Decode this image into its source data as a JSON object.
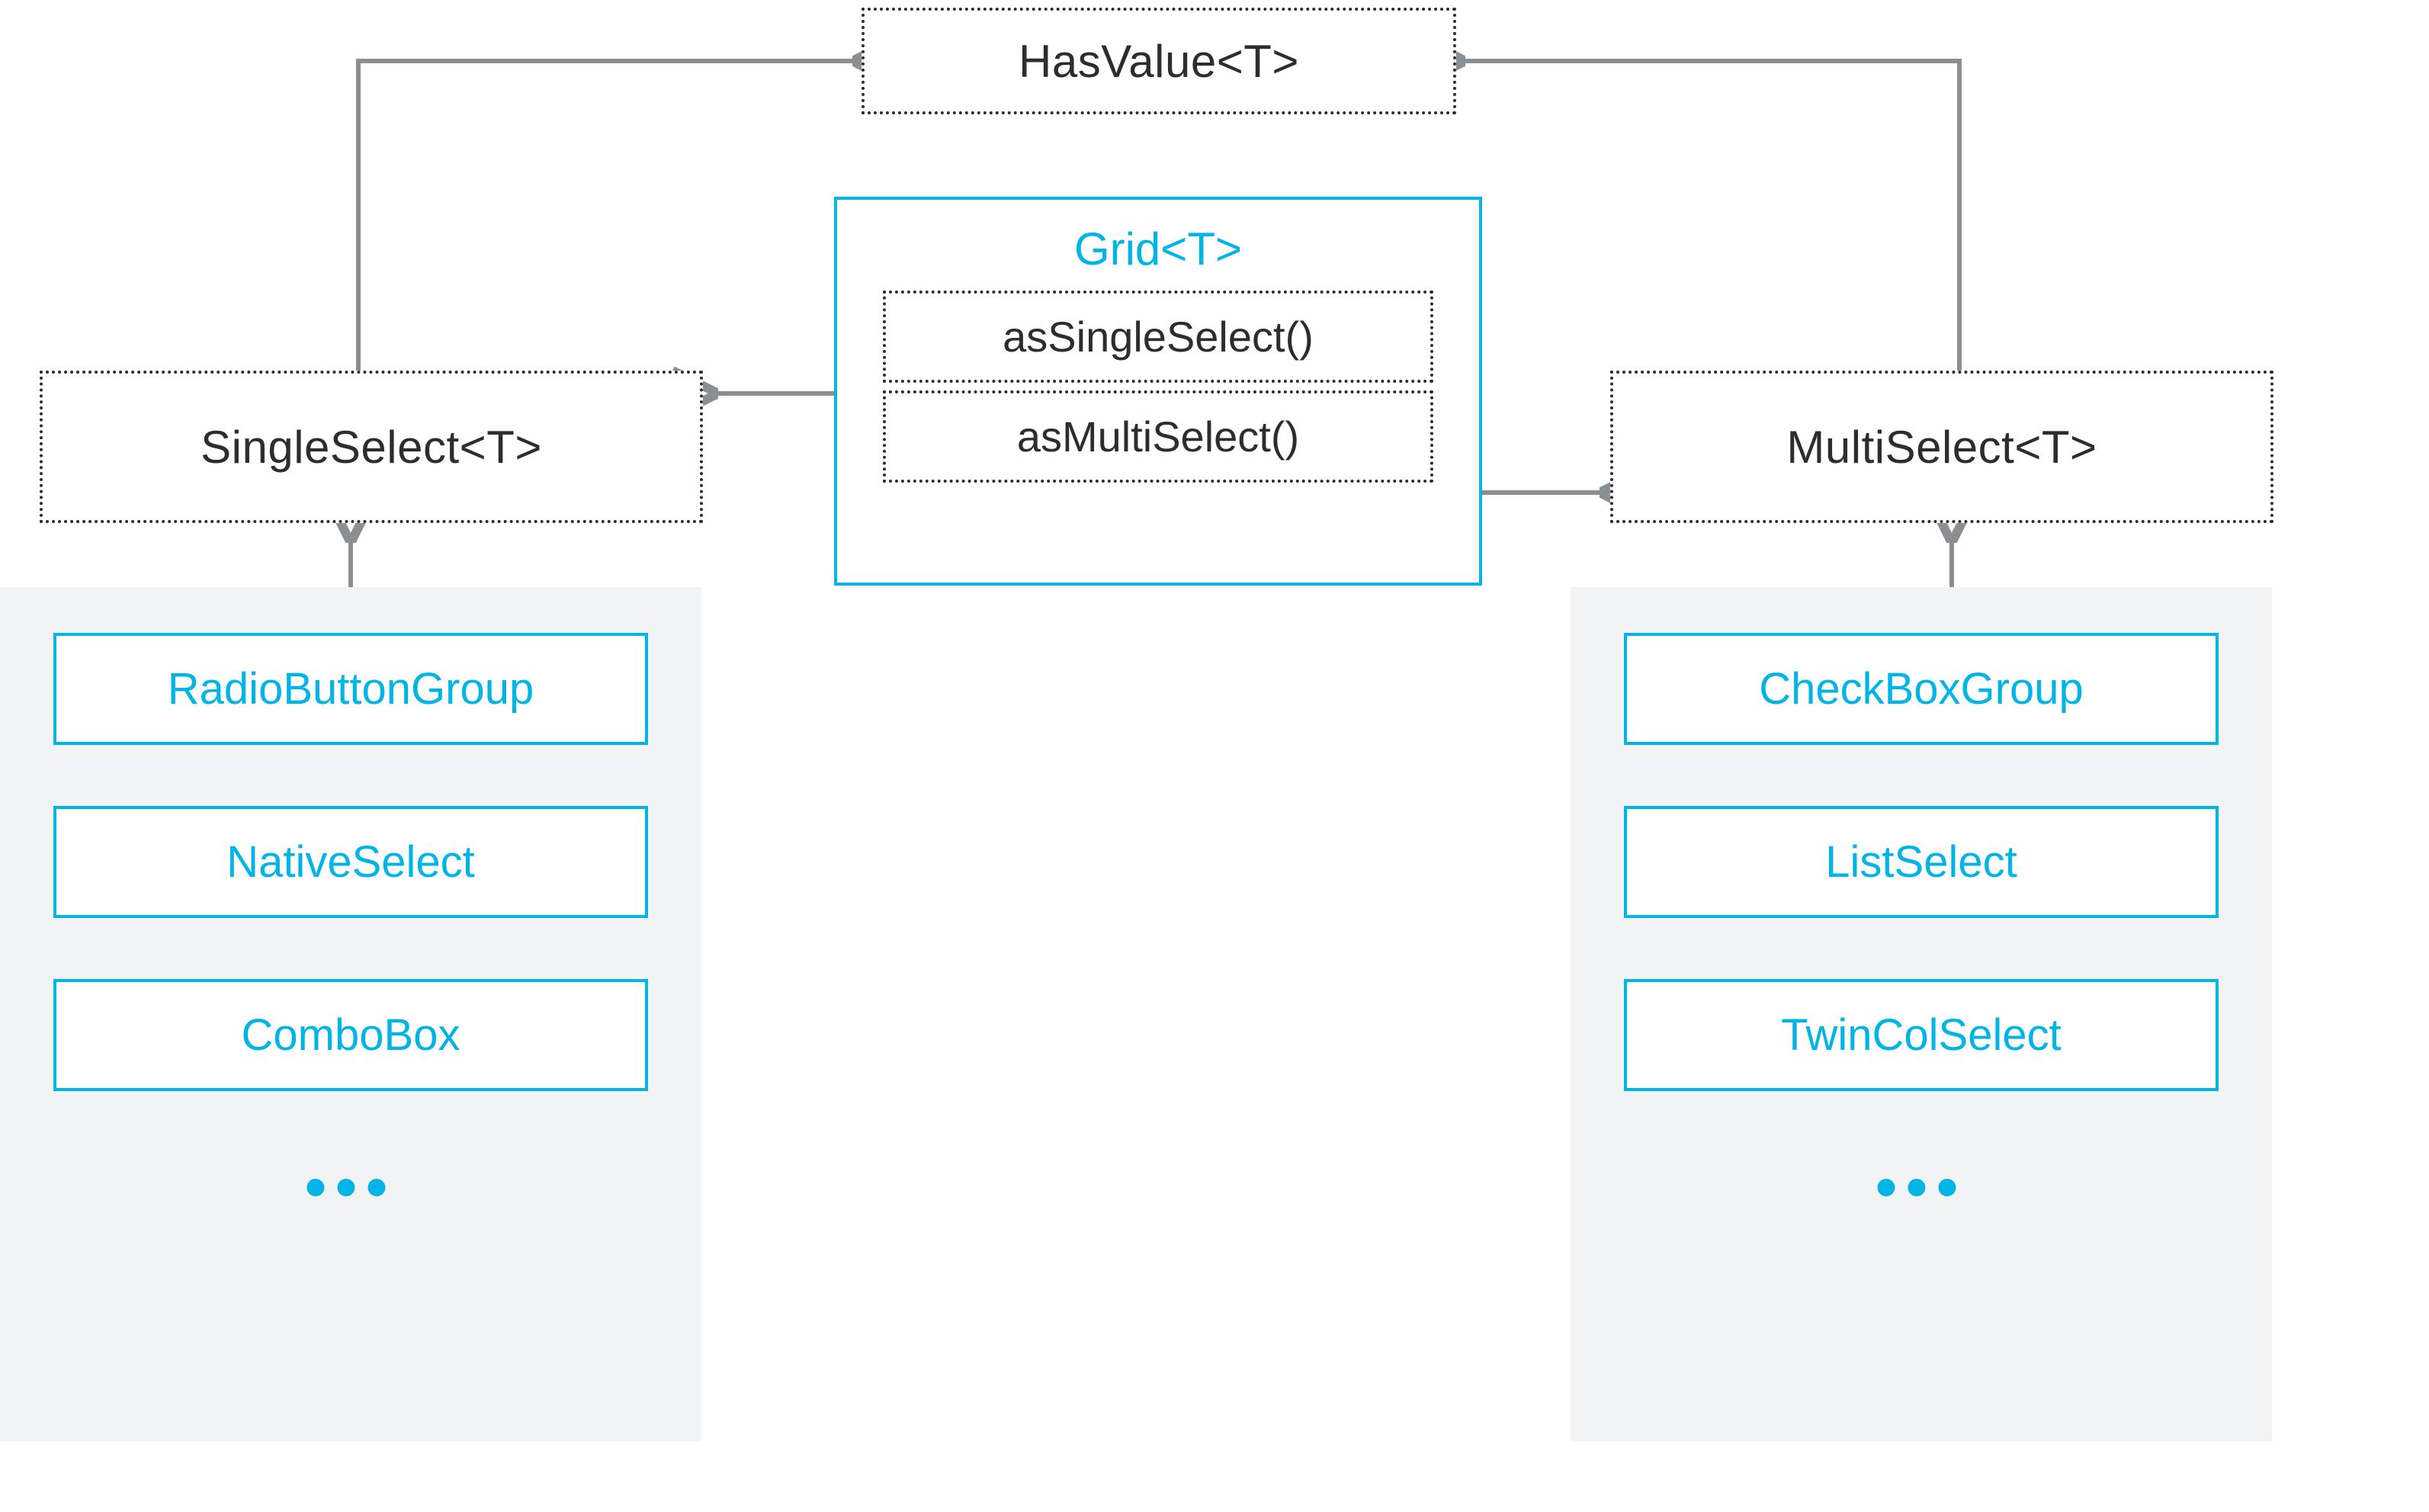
{
  "top": {
    "hasValue": "HasValue<T>"
  },
  "left": {
    "select": "SingleSelect<T>",
    "impls": [
      "RadioButtonGroup",
      "NativeSelect",
      "ComboBox"
    ],
    "ellipsis": "•••"
  },
  "right": {
    "select": "MultiSelect<T>",
    "impls": [
      "CheckBoxGroup",
      "ListSelect",
      "TwinColSelect"
    ],
    "ellipsis": "•••"
  },
  "grid": {
    "title": "Grid<T>",
    "asSingle": "asSingleSelect()",
    "asMulti": "asMultiSelect()"
  },
  "colors": {
    "accent": "#00b4e6",
    "dark": "#2d2d2d",
    "panel": "#f1f3f4",
    "arrow": "#8a8f93"
  }
}
